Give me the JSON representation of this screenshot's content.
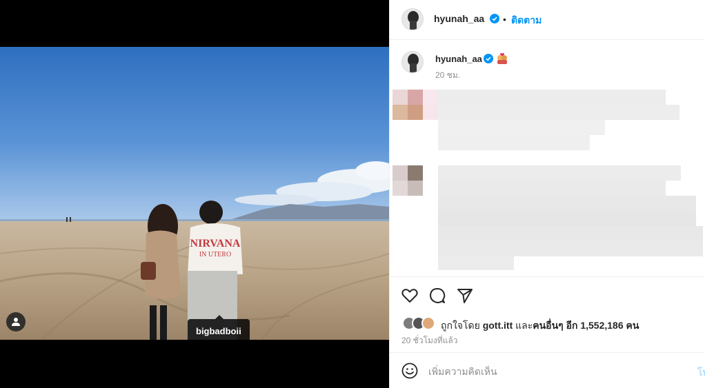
{
  "post": {
    "image_tag": "bigbadboii",
    "photo_alt": "Couple walking on beach",
    "shirt_text_1": "NIRVANA",
    "shirt_text_2": "IN UTERO"
  },
  "header": {
    "username": "hyunah_aa",
    "separator": "•",
    "follow_label": "ติดตาม"
  },
  "caption": {
    "username": "hyunah_aa",
    "time": "20 ชม."
  },
  "actions": {
    "like_icon": "heart-icon",
    "comment_icon": "comment-icon",
    "share_icon": "send-icon"
  },
  "likes": {
    "prefix": "ถูกใจโดย ",
    "first_liker": "gott.itt",
    "middle": " และ",
    "others": "คนอื่นๆ อีก 1,552,186 คน"
  },
  "post_time": "20 ชั่วโมงที่แล้ว",
  "comment": {
    "placeholder": "เพิ่มความคิดเห็น",
    "post_label": "โพสต์"
  },
  "colors": {
    "accent": "#0095f6",
    "verified": "#0095f6",
    "muted": "#8e8e8e"
  }
}
